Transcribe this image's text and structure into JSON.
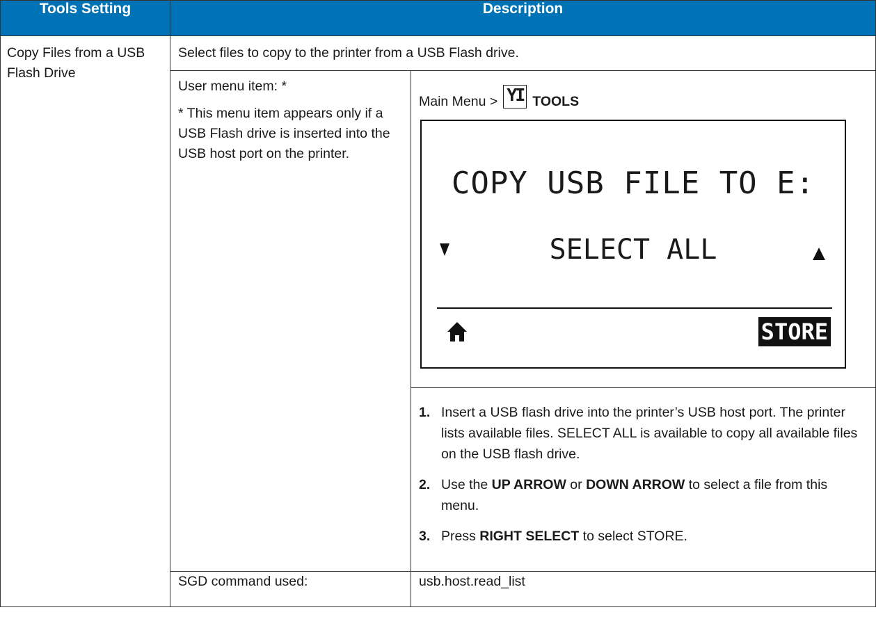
{
  "header": {
    "col1": "Tools Setting",
    "col2": "Description"
  },
  "setting_name": "Copy Files from a USB Flash Drive",
  "summary": "Select files to copy to the printer from a USB Flash drive.",
  "user_menu": {
    "label": "User menu item: *",
    "note": "* This menu item appears only if a USB Flash drive is inserted into the USB host port on the printer."
  },
  "path": {
    "prefix": "Main Menu >",
    "section": "TOOLS",
    "icon": "tools-icon",
    "icon_glyph": "YI"
  },
  "lcd": {
    "line1": "COPY USB FILE TO E:",
    "line2": "SELECT ALL",
    "softkey_right": "STORE",
    "softkey_left_icon": "home-icon"
  },
  "steps": [
    {
      "num": "1.",
      "parts": [
        {
          "text": "Insert a USB flash drive into the printer’s USB host port. The printer lists available files. SELECT ALL is available to copy all available files on the USB flash drive.",
          "bold": false
        }
      ]
    },
    {
      "num": "2.",
      "parts": [
        {
          "text": "Use the ",
          "bold": false
        },
        {
          "text": "UP ARROW",
          "bold": true
        },
        {
          "text": " or ",
          "bold": false
        },
        {
          "text": "DOWN ARROW",
          "bold": true
        },
        {
          "text": " to select a file from this menu.",
          "bold": false
        }
      ]
    },
    {
      "num": "3.",
      "parts": [
        {
          "text": "Press ",
          "bold": false
        },
        {
          "text": "RIGHT SELECT",
          "bold": true
        },
        {
          "text": " to select STORE.",
          "bold": false
        }
      ]
    }
  ],
  "sgd": {
    "label": "SGD command used:",
    "value": "usb.host.read_list"
  }
}
